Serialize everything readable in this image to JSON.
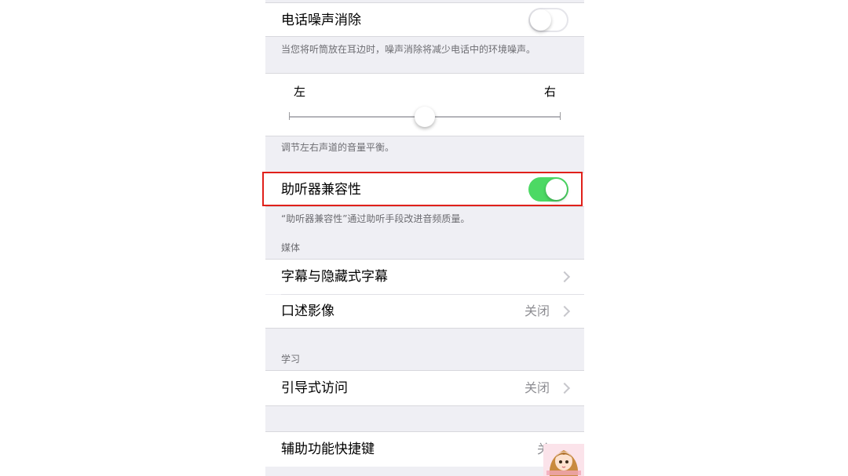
{
  "noise_cancellation": {
    "label": "电话噪声消除",
    "enabled": false,
    "footnote": "当您将听筒放在耳边时，噪声消除将减少电话中的环境噪声。"
  },
  "balance": {
    "left_label": "左",
    "right_label": "右",
    "position": 0.5,
    "footnote": "调节左右声道的音量平衡。"
  },
  "hearing_aid": {
    "label": "助听器兼容性",
    "enabled": true,
    "footnote": "“助听器兼容性”通过助听手段改进音频质量。"
  },
  "media": {
    "header": "媒体",
    "items": [
      {
        "label": "字幕与隐藏式字幕",
        "value": ""
      },
      {
        "label": "口述影像",
        "value": "关闭"
      }
    ]
  },
  "learning": {
    "header": "学习",
    "items": [
      {
        "label": "引导式访问",
        "value": "关闭"
      }
    ]
  },
  "shortcut": {
    "label": "辅助功能快捷键",
    "value": "关"
  },
  "colors": {
    "toggle_on": "#4cd964",
    "highlight": "#e0201a",
    "background": "#efeff4"
  }
}
